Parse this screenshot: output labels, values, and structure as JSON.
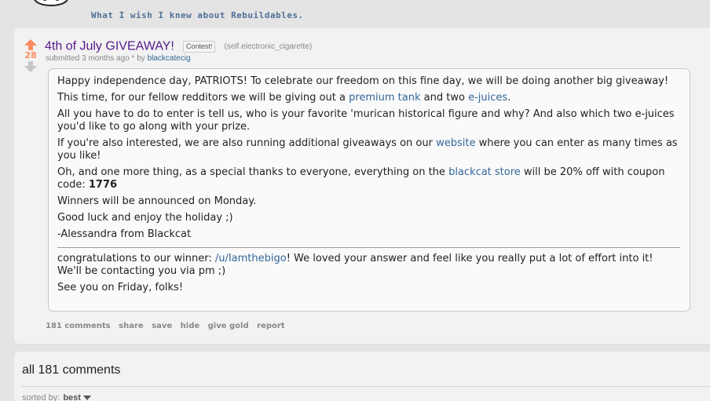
{
  "previous_item": {
    "title": "What I wish I knew about Rebuildables."
  },
  "post": {
    "score": "28",
    "title": "4th of July GIVEAWAY!",
    "flair": "Contest!",
    "domain": "(self.electronic_cigarette)",
    "submitted_prefix": "submitted",
    "time_ago": "3 months ago",
    "asterisk": "*",
    "by": "by",
    "author": "blackcatecig",
    "selftext": {
      "p1": "Happy independence day, PATRIOTS! To celebrate our freedom on this fine day, we will be doing another big giveaway!",
      "p2_before": "This time, for our fellow redditors we will be giving out a ",
      "p2_link1": "premium tank",
      "p2_mid": " and two ",
      "p2_link2": "e-juices",
      "p2_end": ".",
      "p3": "All you have to do to enter is tell us, who is your favorite 'murican historical figure and why? And also which two e-juices you'd like to go along with your prize.",
      "p4_before": "If you're also interested, we are also running additional giveaways on our ",
      "p4_link": "website",
      "p4_after": " where you can enter as many times as you like!",
      "p5_before": "Oh, and one more thing, as a special thanks to everyone, everything on the ",
      "p5_link": "blackcat store",
      "p5_after": " will be 20% off with coupon code: ",
      "p5_code": "1776",
      "p6": "Winners will be announced on Monday.",
      "p7": "Good luck and enjoy the holiday ;)",
      "p8": "-Alessandra from Blackcat",
      "p9_before": "congratulations to our winner: ",
      "p9_link": "/u/Iamthebigo",
      "p9_after": "! We loved your answer and feel like you really put a lot of effort into it! We'll be contacting you via pm ;)",
      "p10": "See you on Friday, folks!"
    },
    "buttons": {
      "comments": "181 comments",
      "share": "share",
      "save": "save",
      "hide": "hide",
      "give_gold": "give gold",
      "report": "report"
    }
  },
  "comments_section": {
    "heading": "all 181 comments",
    "sorted_by_label": "sorted by:",
    "sorted_by_value": "best"
  },
  "colors": {
    "upvote": "#ff8b60",
    "downvote": "#c6c6c6",
    "link": "#336699",
    "visited_title": "#551a8b"
  },
  "icons": {
    "upvote": "arrow-up-icon",
    "downvote": "arrow-down-icon",
    "snoo": "snoo-icon",
    "sort_dropdown": "chevron-down-icon"
  }
}
